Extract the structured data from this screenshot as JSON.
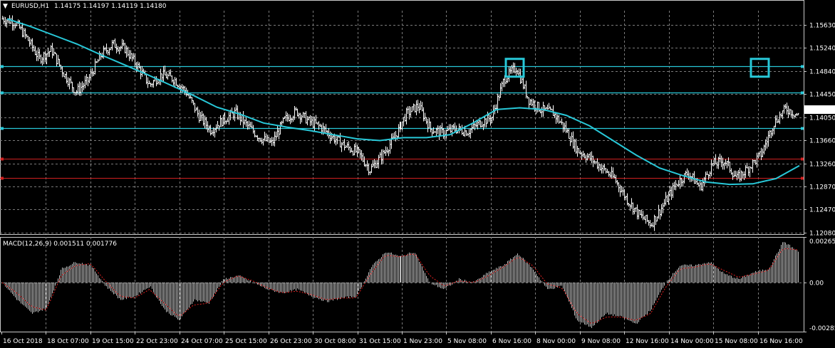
{
  "symbol": "EURUSD,H1",
  "ohlc_text": "1.14175 1.14197 1.14119 1.14180",
  "last_price_label": "1.14180",
  "macd_title": "MACD(12,26,9) 0.001511 0.001776",
  "colors": {
    "background": "#000000",
    "grid": "#7a7a7a",
    "candle": "#ffffff",
    "ma": "#28c8d8",
    "hline_cyan": "#28c8d8",
    "hline_red": "#d02020",
    "macd_hist": "#c0c0c0",
    "macd_signal": "#e02020",
    "text": "#ffffff"
  },
  "chart_data": [
    {
      "type": "candlestick",
      "title": "EURUSD,H1",
      "y_ticks": [
        "1.15630",
        "1.15240",
        "1.14840",
        "1.14450",
        "1.14050",
        "1.13660",
        "1.13260",
        "1.12870",
        "1.12470",
        "1.12080"
      ],
      "ylim": [
        1.1205,
        1.1587
      ],
      "x_ticks": [
        "16 Oct 2018",
        "18 Oct 07:00",
        "19 Oct 15:00",
        "22 Oct 23:00",
        "24 Oct 07:00",
        "25 Oct 15:00",
        "26 Oct 23:00",
        "30 Oct 08:00",
        "31 Oct 15:00",
        "1 Nov 23:00",
        "5 Nov 08:00",
        "6 Nov 16:00",
        "8 Nov 00:00",
        "9 Nov 08:00",
        "12 Nov 16:00",
        "14 Nov 00:00",
        "15 Nov 08:00",
        "16 Nov 16:00"
      ],
      "close_path": [
        1.1573,
        1.1568,
        1.154,
        1.1505,
        1.152,
        1.148,
        1.1448,
        1.1468,
        1.151,
        1.153,
        1.1522,
        1.1493,
        1.146,
        1.1478,
        1.147,
        1.1448,
        1.1408,
        1.1383,
        1.14,
        1.1413,
        1.139,
        1.137,
        1.136,
        1.14,
        1.1415,
        1.1398,
        1.1388,
        1.137,
        1.1355,
        1.1345,
        1.1315,
        1.134,
        1.137,
        1.141,
        1.1425,
        1.1385,
        1.1378,
        1.1385,
        1.138,
        1.1395,
        1.1405,
        1.147,
        1.149,
        1.1435,
        1.1418,
        1.1412,
        1.1385,
        1.1348,
        1.1335,
        1.1318,
        1.13,
        1.1265,
        1.1238,
        1.1222,
        1.1255,
        1.129,
        1.131,
        1.1285,
        1.1325,
        1.133,
        1.13,
        1.132,
        1.1342,
        1.1395,
        1.142,
        1.1408
      ],
      "moving_average": [
        1.1573,
        1.156,
        1.1545,
        1.153,
        1.1512,
        1.1495,
        1.1478,
        1.146,
        1.1442,
        1.1422,
        1.141,
        1.1395,
        1.1388,
        1.1382,
        1.1375,
        1.1368,
        1.1365,
        1.137,
        1.137,
        1.1375,
        1.1395,
        1.1418,
        1.1421,
        1.1418,
        1.1408,
        1.139,
        1.1365,
        1.134,
        1.1318,
        1.1305,
        1.1294,
        1.129,
        1.1291,
        1.13,
        1.1322
      ],
      "horizontal_lines": [
        {
          "value": 1.1492,
          "color": "cyan"
        },
        {
          "value": 1.1447,
          "color": "cyan"
        },
        {
          "value": 1.1386,
          "color": "cyan"
        },
        {
          "value": 1.1334,
          "color": "red"
        },
        {
          "value": 1.1301,
          "color": "red"
        }
      ],
      "markers": [
        {
          "shape": "square",
          "at_tick": "6 Nov 16:00",
          "value": 1.149
        },
        {
          "shape": "square",
          "at_tick": "16 Nov 16:00",
          "value": 1.149
        }
      ],
      "grid": true
    },
    {
      "type": "bar",
      "title": "MACD(12,26,9) 0.001511 0.001776",
      "y_ticks": [
        "0.002652",
        "0.00",
        "-0.002854"
      ],
      "ylim": [
        -0.002854,
        0.002652
      ],
      "histogram_path": [
        0.0,
        -0.001,
        -0.0018,
        -0.0015,
        0.0008,
        0.0012,
        0.001,
        -0.0002,
        -0.001,
        -0.0008,
        -0.0002,
        -0.0016,
        -0.0022,
        -0.001,
        -0.0012,
        0.0002,
        0.0004,
        0.0,
        -0.0004,
        -0.0006,
        -0.0004,
        -0.0008,
        -0.0011,
        -0.0009,
        -0.0008,
        0.0009,
        0.0018,
        0.0015,
        0.0018,
        0.0,
        -0.0004,
        0.0002,
        0.0,
        0.0006,
        0.001,
        0.0017,
        0.0008,
        -0.0004,
        -0.0002,
        -0.0022,
        -0.0026,
        -0.0018,
        -0.002,
        -0.0024,
        -0.0016,
        0.0,
        0.001,
        0.001,
        0.0012,
        0.0005,
        0.0002,
        0.0006,
        0.0008,
        0.0024,
        0.0018
      ],
      "signal_path": [
        0.0,
        -0.0006,
        -0.0014,
        -0.0016,
        0.0004,
        0.001,
        0.0011,
        0.0001,
        -0.0008,
        -0.0009,
        -0.0004,
        -0.0012,
        -0.002,
        -0.0013,
        -0.0012,
        0.0,
        0.0004,
        0.0001,
        -0.0003,
        -0.0006,
        -0.0005,
        -0.0007,
        -0.001,
        -0.0009,
        -0.0009,
        0.0005,
        0.0016,
        0.0015,
        0.0017,
        0.0004,
        -0.0002,
        0.0001,
        0.0,
        0.0004,
        0.0009,
        0.0015,
        0.001,
        -0.0001,
        -0.0003,
        -0.0018,
        -0.0024,
        -0.002,
        -0.002,
        -0.0022,
        -0.0018,
        -0.0003,
        0.0008,
        0.0009,
        0.0011,
        0.0007,
        0.0003,
        0.0005,
        0.0007,
        0.002,
        0.0019
      ],
      "grid": true
    }
  ]
}
